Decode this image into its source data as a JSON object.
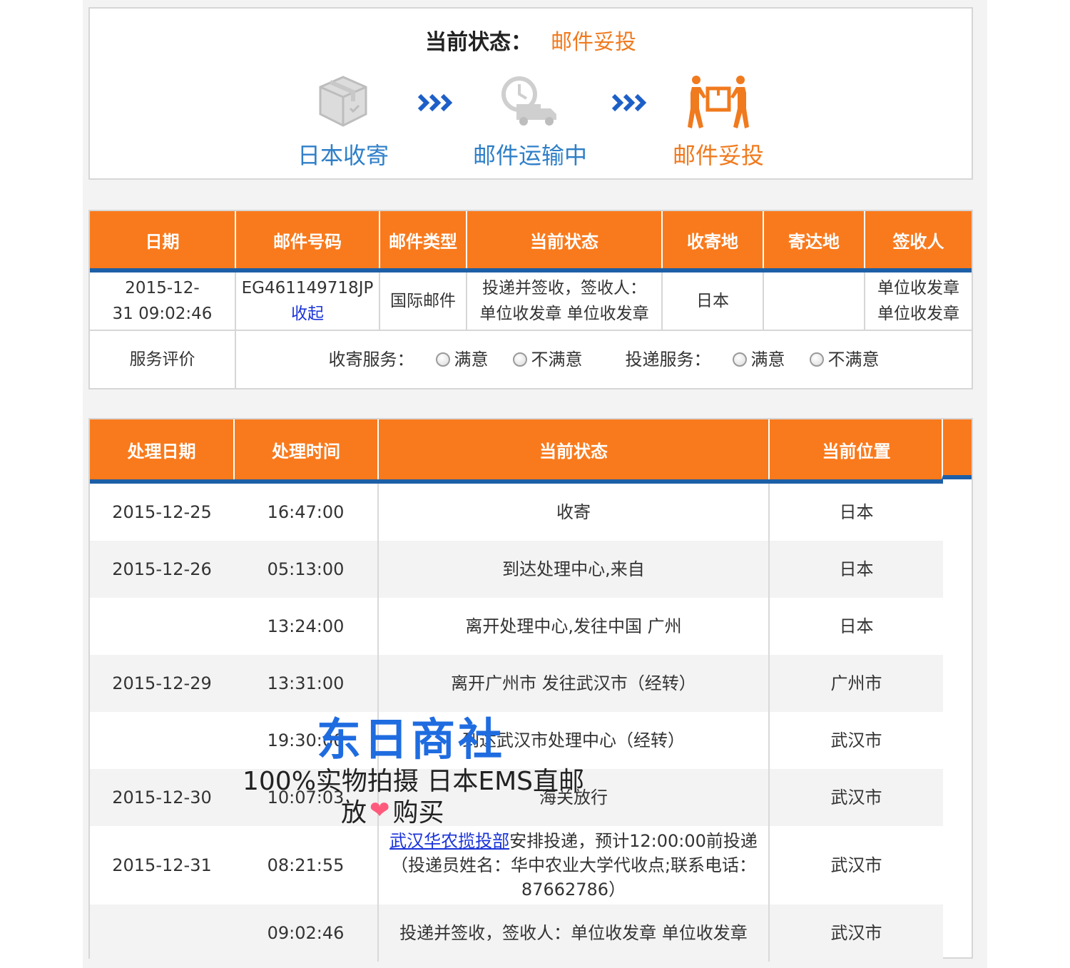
{
  "status": {
    "label": "当前状态：",
    "value": "邮件妥投",
    "steps": [
      {
        "label": "日本收寄",
        "icon": "package-box-icon",
        "state": "done"
      },
      {
        "label": "邮件运输中",
        "icon": "delivery-truck-icon",
        "state": "done"
      },
      {
        "label": "邮件妥投",
        "icon": "people-carrying-box-icon",
        "state": "current"
      }
    ],
    "arrow_icon": "triple-chevron-right-icon"
  },
  "summary": {
    "headers": [
      "日期",
      "邮件号码",
      "邮件类型",
      "当前状态",
      "收寄地",
      "寄达地",
      "签收人"
    ],
    "row": {
      "date_line1": "2015-12-",
      "date_line2": "31 09:02:46",
      "mail_no": "EG461149718JP",
      "pickup_link": "收起",
      "mail_type": "国际邮件",
      "status_line1": "投递并签收，签收人：",
      "status_line2": "单位收发章 单位收发章",
      "origin": "日本",
      "destination": "",
      "signer_line1": "单位收发章",
      "signer_line2": "单位收发章"
    },
    "rating": {
      "label": "服务评价",
      "pickup_service": "收寄服务：",
      "delivery_service": "投递服务：",
      "satisfied": "满意",
      "unsatisfied": "不满意"
    }
  },
  "trace": {
    "headers": [
      "处理日期",
      "处理时间",
      "当前状态",
      "当前位置"
    ],
    "rows": [
      {
        "date": "2015-12-25",
        "time": "16:47:00",
        "status": "收寄",
        "location": "日本"
      },
      {
        "date": "2015-12-26",
        "time": "05:13:00",
        "status": "到达处理中心,来自",
        "location": "日本"
      },
      {
        "date": "",
        "time": "13:24:00",
        "status": "离开处理中心,发往中国 广州",
        "location": "日本"
      },
      {
        "date": "2015-12-29",
        "time": "13:31:00",
        "status": "离开广州市 发往武汉市（经转）",
        "location": "广州市"
      },
      {
        "date": "",
        "time": "19:30:00",
        "status": "到达武汉市处理中心（经转）",
        "location": "武汉市"
      },
      {
        "date": "2015-12-30",
        "time": "10:07:03",
        "status": "海关放行",
        "location": "武汉市"
      },
      {
        "date": "2015-12-31",
        "time": "08:21:55",
        "status_link": "武汉华农揽投部",
        "status": "安排投递，预计12:00:00前投递",
        "status_line2": "（投递员姓名：华中农业大学代收点;联系电话：",
        "status_line3": "87662786）",
        "location": "武汉市"
      },
      {
        "date": "",
        "time": "09:02:46",
        "status": "投递并签收，签收人：单位收发章 单位收发章",
        "location": "武汉市"
      }
    ]
  },
  "watermark": {
    "title": "东日商社",
    "line2": "100%实物拍摄 日本EMS直邮",
    "line3_a": "放",
    "line3_heart": "❤",
    "line3_b": "购买"
  },
  "colors": {
    "header_orange": "#f97a1c",
    "header_underline_blue": "#1d5fa7",
    "step_done_blue": "#2f7fc8",
    "status_orange": "#f07a1e",
    "link_blue": "#1a33d9",
    "watermark_blue": "#1f6ce0"
  }
}
